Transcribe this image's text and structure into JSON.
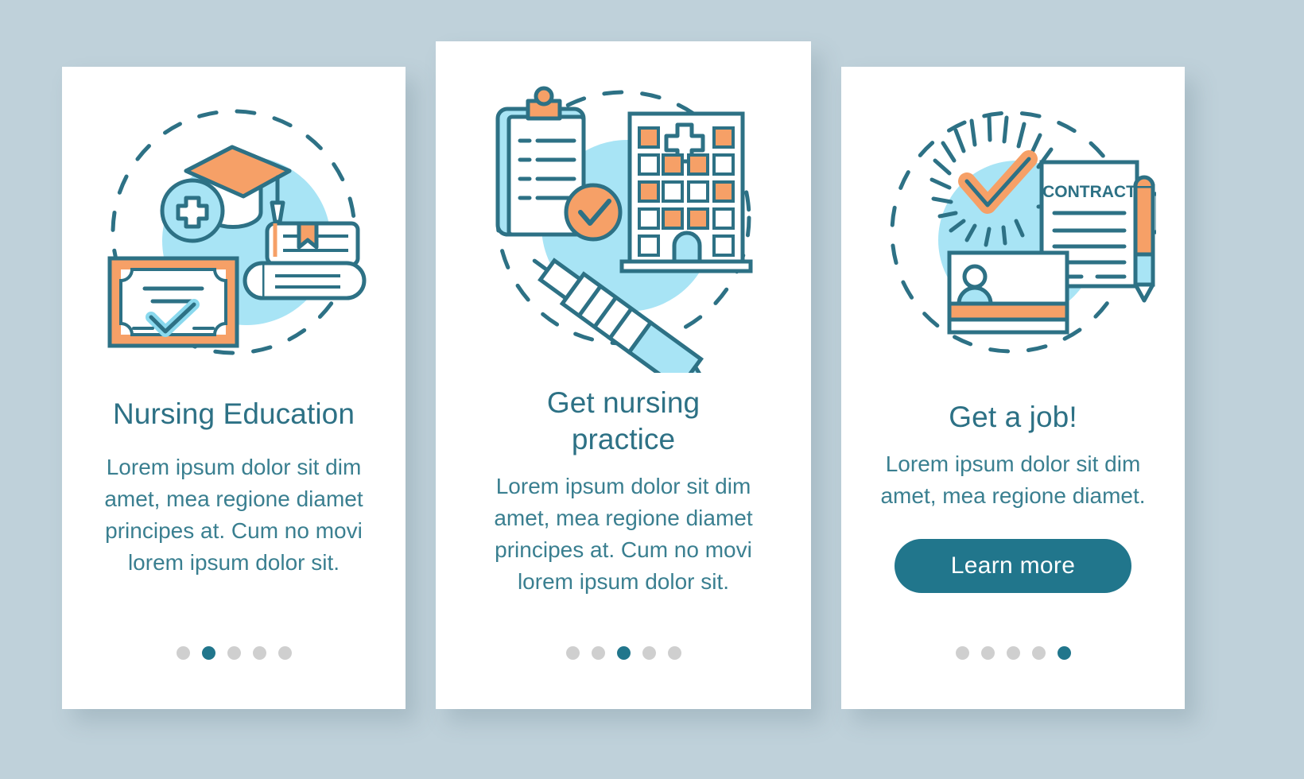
{
  "theme": {
    "background": "#bfd1da",
    "card_bg": "#ffffff",
    "teal": "#21768c",
    "teal_text": "#2d7185",
    "body_text": "#3a7f90",
    "orange": "#f6a067",
    "light_blue": "#a8e4f5",
    "dot_inactive": "#cfcfcf"
  },
  "screens": [
    {
      "id": "nursing-education",
      "illustration": "graduation-cap-diploma-books-illustration",
      "title": "Nursing Education",
      "body": "Lorem ipsum dolor sit dim amet, mea regione diamet principes at. Cum no movi lorem ipsum dolor sit.",
      "pagination": {
        "total": 5,
        "active_index": 1
      },
      "cta": null
    },
    {
      "id": "get-nursing-practice",
      "illustration": "clipboard-hospital-syringe-illustration",
      "title": "Get nursing practice",
      "body": "Lorem ipsum dolor sit dim amet, mea regione diamet principes at. Cum no movi lorem ipsum dolor sit.",
      "pagination": {
        "total": 5,
        "active_index": 2
      },
      "cta": null
    },
    {
      "id": "get-a-job",
      "illustration": "contract-id-card-pen-check-illustration",
      "title": "Get a job!",
      "body": "Lorem ipsum dolor sit dim amet, mea regione diamet.",
      "pagination": {
        "total": 5,
        "active_index": 4
      },
      "cta": "Learn more"
    }
  ],
  "illustration_labels": {
    "contract_document": "CONTRACT"
  }
}
